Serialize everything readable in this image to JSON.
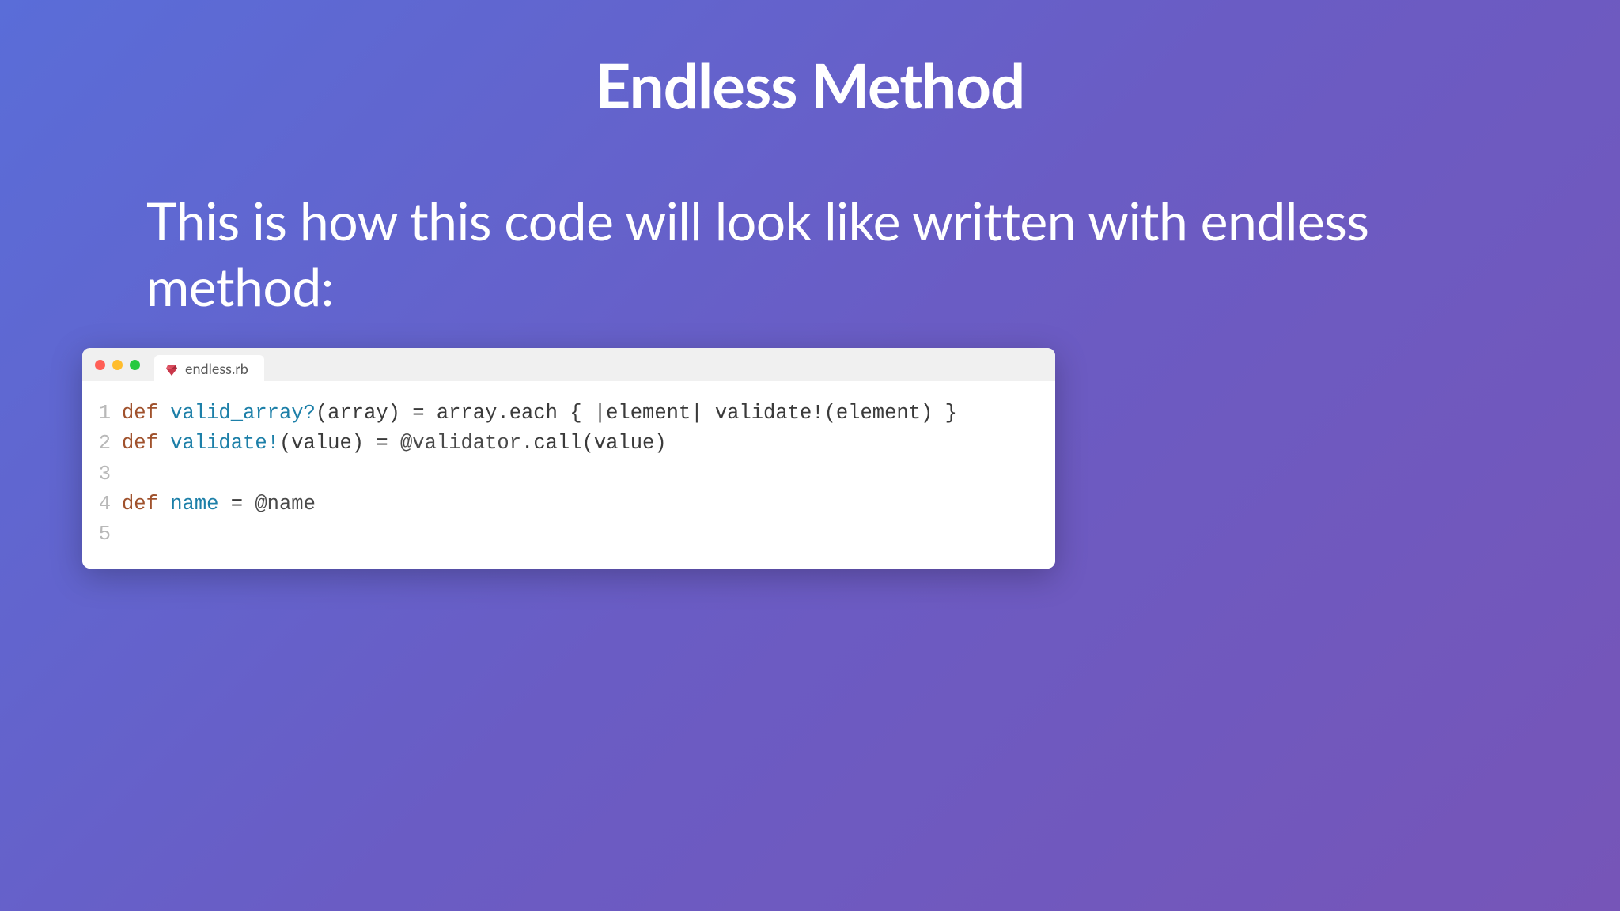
{
  "title": "Endless Method",
  "subtitle": "This is how this code will look like written with endless method:",
  "window": {
    "tab_filename": "endless.rb"
  },
  "code": {
    "lines": [
      {
        "num": "1",
        "tokens": [
          {
            "t": "def ",
            "cls": "tok-kw"
          },
          {
            "t": "valid_array?",
            "cls": "tok-method"
          },
          {
            "t": "(array) = array.each { |element| validate!(element) }",
            "cls": "tok-text"
          }
        ]
      },
      {
        "num": "2",
        "tokens": [
          {
            "t": "def ",
            "cls": "tok-kw"
          },
          {
            "t": "validate!",
            "cls": "tok-method"
          },
          {
            "t": "(value) = ",
            "cls": "tok-text"
          },
          {
            "t": "@validator",
            "cls": "tok-ivar"
          },
          {
            "t": ".call(value)",
            "cls": "tok-text"
          }
        ]
      },
      {
        "num": "3",
        "tokens": []
      },
      {
        "num": "4",
        "tokens": [
          {
            "t": "def ",
            "cls": "tok-kw"
          },
          {
            "t": "name",
            "cls": "tok-method"
          },
          {
            "t": " = ",
            "cls": "tok-text"
          },
          {
            "t": "@name",
            "cls": "tok-ivar"
          }
        ]
      },
      {
        "num": "5",
        "tokens": []
      }
    ]
  }
}
